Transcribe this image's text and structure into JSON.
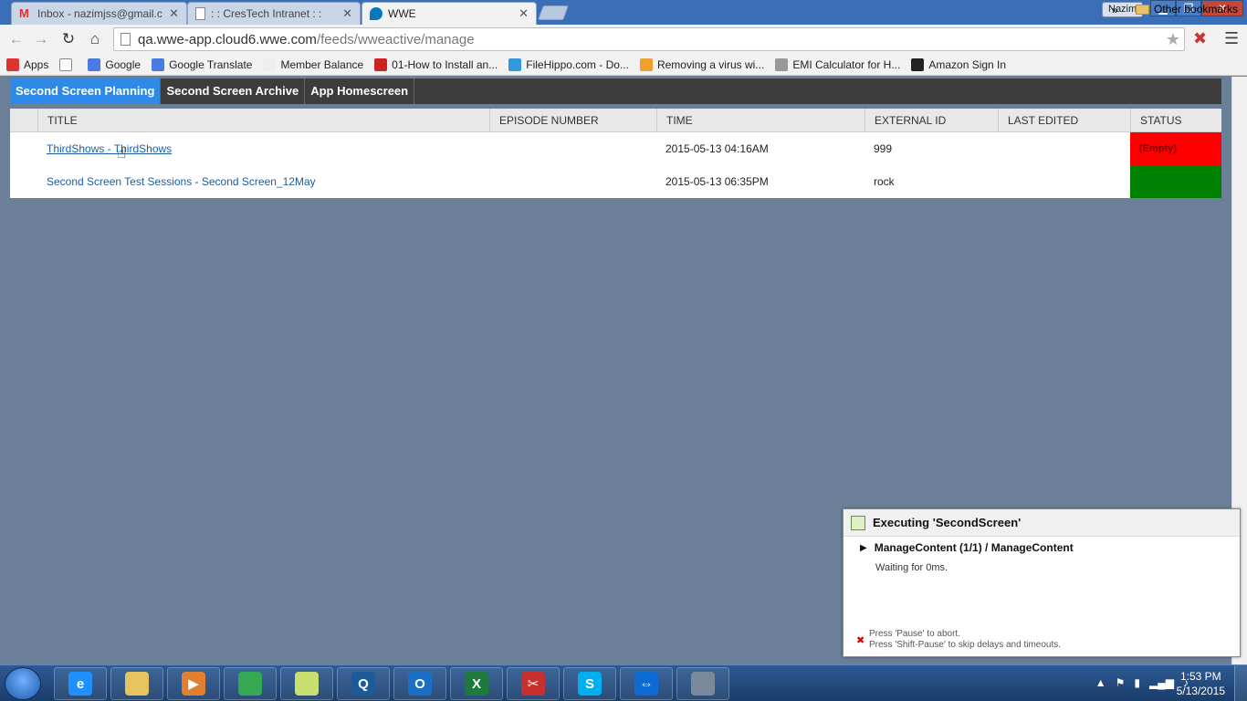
{
  "browser": {
    "tabs": [
      {
        "label": "Inbox - nazimjss@gmail.c",
        "close": "✕",
        "icon": "gmail-icon"
      },
      {
        "label": ": : CresTech Intranet : :",
        "close": "✕",
        "icon": "page-icon"
      },
      {
        "label": "WWE",
        "close": "✕",
        "icon": "drupal-icon",
        "active": true
      }
    ],
    "user": "Nazim",
    "url": {
      "host": "qa.wwe-app.cloud6.wwe.com",
      "path": "/feeds/wweactive/manage"
    },
    "bookmarks": [
      {
        "label": "Apps",
        "icon": "apps-grid-icon",
        "color": "#d33"
      },
      {
        "label": "",
        "icon": "blank-page-icon",
        "color": "#ffffff"
      },
      {
        "label": "Google",
        "icon": "google-icon",
        "color": "#4a7be0"
      },
      {
        "label": "Google Translate",
        "icon": "translate-icon",
        "color": "#4a7be0"
      },
      {
        "label": "Member Balance",
        "icon": "member-icon",
        "color": "#eeeeee"
      },
      {
        "label": "01-How to Install an...",
        "icon": "youtube-icon",
        "color": "#cc2222"
      },
      {
        "label": "FileHippo.com - Do...",
        "icon": "filehippo-icon",
        "color": "#3399dd"
      },
      {
        "label": "Removing a virus wi...",
        "icon": "virus-icon",
        "color": "#f0a030"
      },
      {
        "label": "EMI Calculator for H...",
        "icon": "calculator-icon",
        "color": "#999999"
      },
      {
        "label": "Amazon Sign In",
        "icon": "amazon-icon",
        "color": "#222222"
      }
    ],
    "bookmarks_more": "»",
    "other_bookmarks": "Other bookmarks"
  },
  "app": {
    "nav": [
      {
        "label": "Second Screen Planning",
        "active": true
      },
      {
        "label": "Second Screen Archive",
        "active": false
      },
      {
        "label": "App Homescreen",
        "active": false
      }
    ],
    "columns": [
      "TITLE",
      "EPISODE NUMBER",
      "TIME",
      "EXTERNAL ID",
      "LAST EDITED",
      "STATUS"
    ],
    "rows": [
      {
        "title": "ThirdShows - ThirdShows",
        "episode": "",
        "time": "2015-05-13 04:16AM",
        "external_id": "999",
        "last_edited": "",
        "status": "(Empty)",
        "status_color": "#ff0000"
      },
      {
        "title": "Second Screen Test Sessions - Second Screen_12May",
        "episode": "",
        "time": "2015-05-13 06:35PM",
        "external_id": "rock",
        "last_edited": "",
        "status": "",
        "status_color": "#008000"
      }
    ]
  },
  "exec_popup": {
    "title": "Executing 'SecondScreen'",
    "step": "ManageContent (1/1) / ManageContent",
    "wait": "Waiting for 0ms.",
    "hint1": "Press 'Pause' to abort.",
    "hint2": "Press 'Shift-Pause' to skip delays and timeouts."
  },
  "taskbar": {
    "apps": [
      {
        "name": "internet-explorer",
        "glyph": "e",
        "color": "#1e90ff"
      },
      {
        "name": "file-explorer",
        "glyph": "",
        "color": "#e6c35c"
      },
      {
        "name": "media-player",
        "glyph": "▶",
        "color": "#e08030"
      },
      {
        "name": "chrome",
        "glyph": "",
        "color": "#34a853"
      },
      {
        "name": "sticky-notes",
        "glyph": "",
        "color": "#c9e070"
      },
      {
        "name": "chat-app",
        "glyph": "Q",
        "color": "#1d5a99"
      },
      {
        "name": "outlook",
        "glyph": "O",
        "color": "#1a6fc4"
      },
      {
        "name": "excel",
        "glyph": "X",
        "color": "#1d7a3a"
      },
      {
        "name": "tools-app",
        "glyph": "✂",
        "color": "#c83030"
      },
      {
        "name": "skype",
        "glyph": "S",
        "color": "#00aff0"
      },
      {
        "name": "teamviewer",
        "glyph": "⇔",
        "color": "#0e6bd6"
      },
      {
        "name": "window-app",
        "glyph": "",
        "color": "#7a8a9a"
      }
    ],
    "time": "1:53 PM",
    "date": "5/13/2015"
  }
}
